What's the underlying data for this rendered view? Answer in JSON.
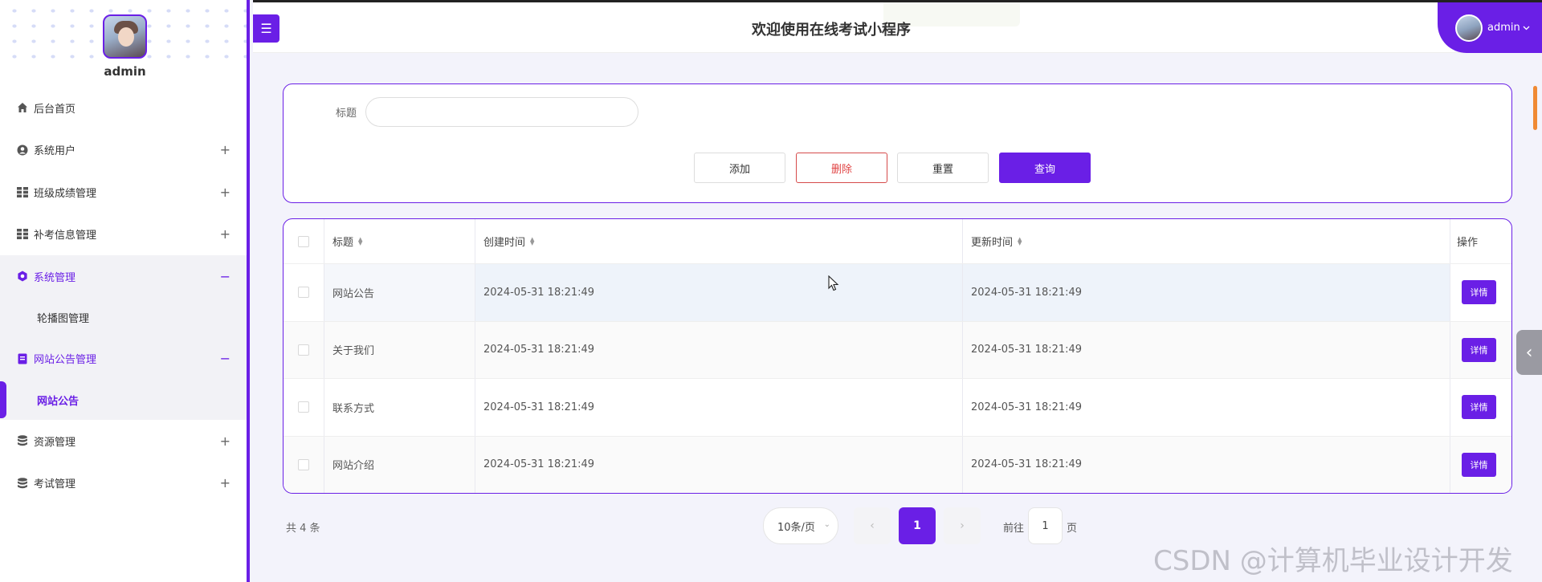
{
  "sidebar": {
    "username": "admin",
    "menu": {
      "home": {
        "label": "后台首页"
      },
      "system_user": {
        "label": "系统用户",
        "toggle": "+"
      },
      "class_score": {
        "label": "班级成绩管理",
        "toggle": "+"
      },
      "makeup_info": {
        "label": "补考信息管理",
        "toggle": "+"
      },
      "system_manage": {
        "label": "系统管理",
        "toggle": "−",
        "sub": "轮播图管理"
      },
      "notice_manage": {
        "label": "网站公告管理",
        "toggle": "−",
        "sub": "网站公告"
      },
      "resource": {
        "label": "资源管理",
        "toggle": "+"
      },
      "exam": {
        "label": "考试管理",
        "toggle": "+"
      }
    }
  },
  "header": {
    "menu_icon": "☰",
    "title": "欢迎使用在线考试小程序",
    "user": "admin"
  },
  "search": {
    "label": "标题",
    "placeholder": "",
    "buttons": {
      "add": "添加",
      "delete": "删除",
      "reset": "重置",
      "query": "查询"
    }
  },
  "table": {
    "columns": {
      "title": "标题",
      "created": "创建时间",
      "updated": "更新时间",
      "op": "操作"
    },
    "rows": [
      {
        "title": "网站公告",
        "created": "2024-05-31 18:21:49",
        "updated": "2024-05-31 18:21:49",
        "action": "详情"
      },
      {
        "title": "关于我们",
        "created": "2024-05-31 18:21:49",
        "updated": "2024-05-31 18:21:49",
        "action": "详情"
      },
      {
        "title": "联系方式",
        "created": "2024-05-31 18:21:49",
        "updated": "2024-05-31 18:21:49",
        "action": "详情"
      },
      {
        "title": "网站介绍",
        "created": "2024-05-31 18:21:49",
        "updated": "2024-05-31 18:21:49",
        "action": "详情"
      }
    ]
  },
  "pagination": {
    "total": "共 4 条",
    "page_size": "10条/页",
    "prev": "‹",
    "current": "1",
    "next": "›",
    "goto_pre": "前往",
    "goto_value": "1",
    "goto_post": "页"
  },
  "side_tab_icon": "‹",
  "watermark": "CSDN @计算机毕业设计开发",
  "colors": {
    "accent": "#6a1fe6",
    "danger": "#e04545"
  }
}
